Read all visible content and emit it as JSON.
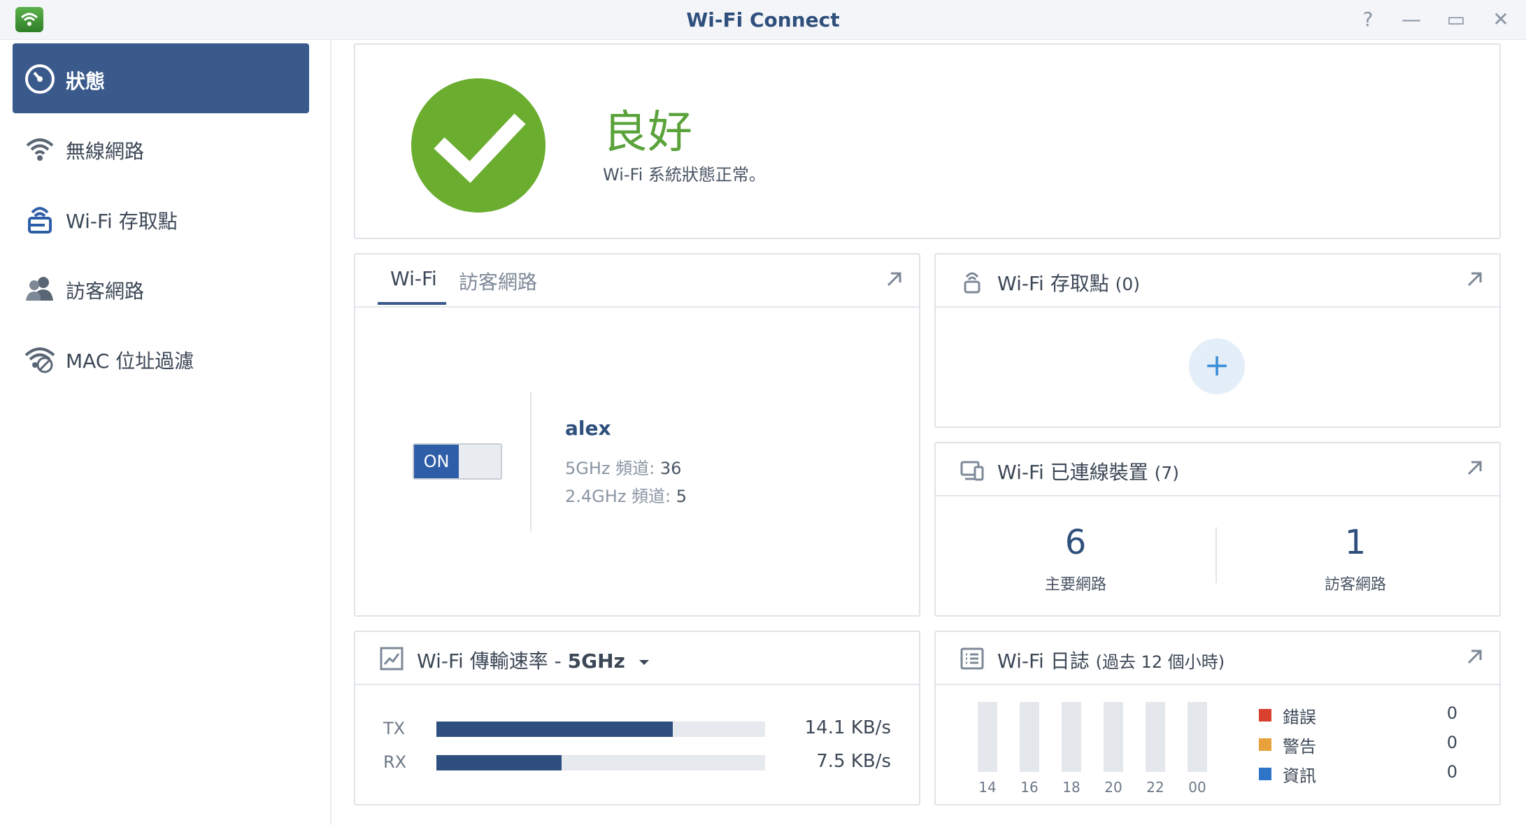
{
  "window": {
    "title": "Wi-Fi Connect",
    "buttons": [
      "?",
      "—",
      "▭",
      "✕"
    ]
  },
  "sidebar": {
    "items": [
      {
        "label": "狀態",
        "icon": "gauge-icon",
        "active": true
      },
      {
        "label": "無線網路",
        "icon": "wifi-icon",
        "active": false
      },
      {
        "label": "Wi-Fi 存取點",
        "icon": "access-point-icon",
        "active": false
      },
      {
        "label": "訪客網路",
        "icon": "guest-users-icon",
        "active": false
      },
      {
        "label": "MAC 位址過濾",
        "icon": "wifi-filter-icon",
        "active": false
      }
    ]
  },
  "status": {
    "headline": "良好",
    "description": "Wi-Fi 系統狀態正常。",
    "color": "#6aad2f"
  },
  "wifi_panel": {
    "tabs": [
      "Wi-Fi",
      "訪客網路"
    ],
    "toggle_label": "ON",
    "ssid": "alex",
    "band_5_label": "5GHz 頻道:",
    "band_5_value": "36",
    "band_24_label": "2.4GHz 頻道:",
    "band_24_value": "5"
  },
  "access_point_panel": {
    "title": "Wi-Fi 存取點",
    "count": "(0)",
    "add_label": "+"
  },
  "devices_panel": {
    "title": "Wi-Fi 已連線裝置",
    "count": "(7)",
    "main_count": "6",
    "main_label": "主要網路",
    "guest_count": "1",
    "guest_label": "訪客網路"
  },
  "rate_panel": {
    "title": "Wi-Fi 傳輸速率",
    "separator": "-",
    "band": "5GHz",
    "tx_label": "TX",
    "tx_value": "14.1 KB/s",
    "tx_fraction": 0.72,
    "rx_label": "RX",
    "rx_value": "7.5 KB/s",
    "rx_fraction": 0.38
  },
  "log_panel": {
    "title": "Wi-Fi 日誌",
    "subtitle": "(過去 12 個小時)",
    "hours": [
      "14",
      "16",
      "18",
      "20",
      "22",
      "00"
    ],
    "legend": [
      {
        "label": "錯誤",
        "value": "0",
        "color": "#d9412e"
      },
      {
        "label": "警告",
        "value": "0",
        "color": "#e9a23b"
      },
      {
        "label": "資訊",
        "value": "0",
        "color": "#2e74c9"
      }
    ]
  }
}
